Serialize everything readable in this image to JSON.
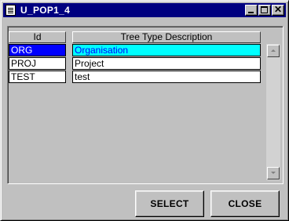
{
  "window": {
    "title": "U_POP1_4"
  },
  "titlebar_buttons": {
    "close_glyph": "✕"
  },
  "table": {
    "columns": [
      "Id",
      "Tree Type Description"
    ],
    "rows": [
      {
        "id": "ORG",
        "description": "Organisation",
        "selected": true
      },
      {
        "id": "PROJ",
        "description": "Project",
        "selected": false
      },
      {
        "id": "TEST",
        "description": "test",
        "selected": false
      }
    ]
  },
  "buttons": {
    "select": "SELECT",
    "close": "CLOSE"
  },
  "colors": {
    "title_bg": "#000080",
    "selected_id_bg": "#0000ff",
    "selected_desc_bg": "#00ffff",
    "face": "#c0c0c0"
  }
}
